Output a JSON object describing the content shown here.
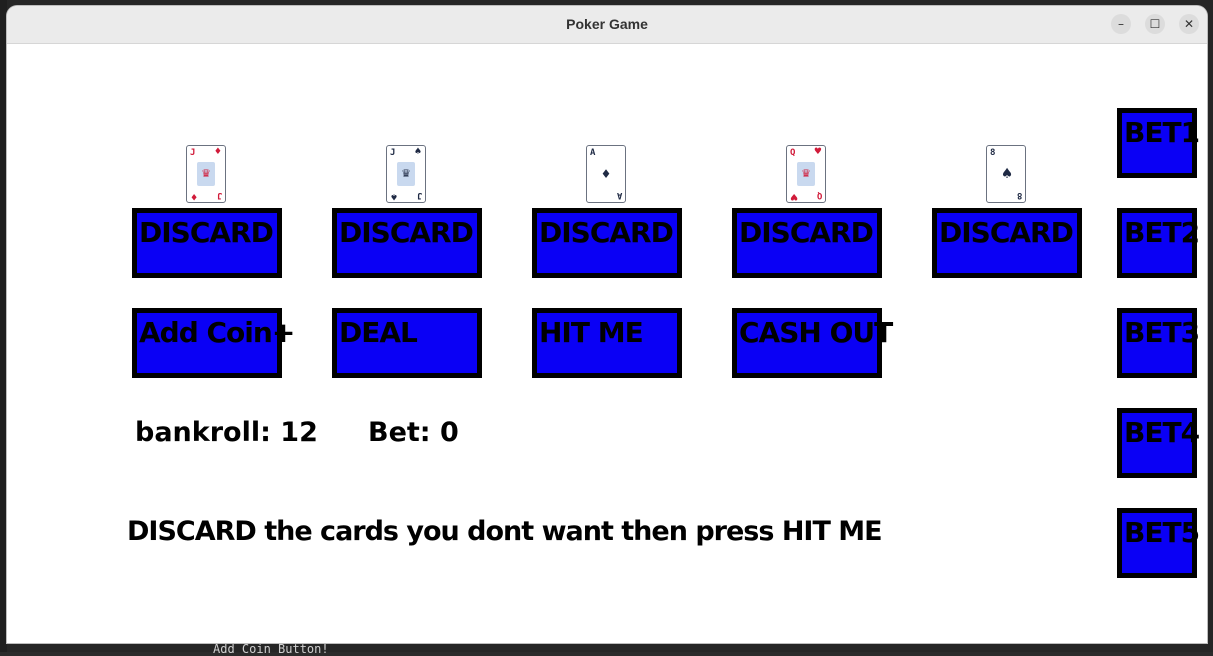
{
  "background": {
    "bottom_text": "Add Coin Button!"
  },
  "window": {
    "title": "Poker Game",
    "controls": {
      "minimize": "–",
      "maximize": "☐",
      "close": "✕"
    }
  },
  "cards": [
    {
      "rank": "J",
      "suit": "♦",
      "color": "red",
      "face": "♛"
    },
    {
      "rank": "J",
      "suit": "♠",
      "color": "black",
      "face": "♛"
    },
    {
      "rank": "A",
      "suit": "♦",
      "color": "black",
      "face": ""
    },
    {
      "rank": "Q",
      "suit": "♥",
      "color": "red",
      "face": "♛"
    },
    {
      "rank": "8",
      "suit": "♠",
      "color": "black",
      "face": ""
    }
  ],
  "discard_buttons": [
    "DISCARD",
    "DISCARD",
    "DISCARD",
    "DISCARD",
    "DISCARD"
  ],
  "action_buttons": {
    "add_coin": "Add Coin+",
    "deal": "DEAL",
    "hit_me": "HIT ME",
    "cash_out": "CASH OUT"
  },
  "bet_buttons": [
    "BET1",
    "BET2",
    "BET3",
    "BET4",
    "BET5"
  ],
  "status": {
    "bankroll": "bankroll: 12",
    "bet": "Bet: 0"
  },
  "instruction": "DISCARD the cards you dont want then press HIT ME",
  "colors": {
    "button_fill": "#0a00f5",
    "button_border": "#000000",
    "card_red": "#d11b3a",
    "card_black": "#1f2a44"
  }
}
